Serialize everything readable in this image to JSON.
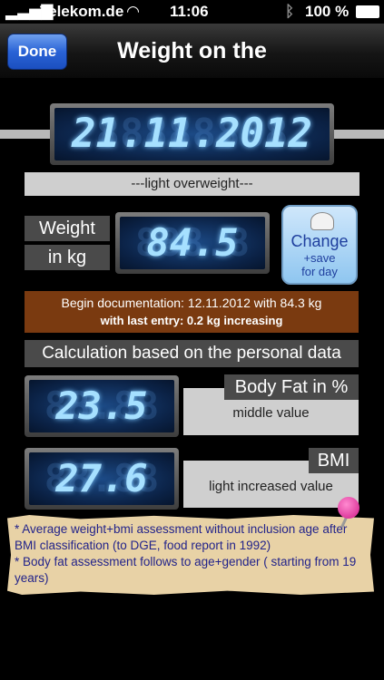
{
  "status": {
    "carrier": "Telekom.de",
    "time": "11:06",
    "battery": "100 %"
  },
  "nav": {
    "done_label": "Done",
    "title": "Weight on the"
  },
  "date_display": "21.11.2012",
  "classification": "---light overweight---",
  "weight": {
    "label_line1": "Weight",
    "label_line2": "in kg",
    "value": "84.5"
  },
  "change_button": {
    "line1": "Change",
    "line2": "+save",
    "line3": "for day"
  },
  "documentation": {
    "line1": "Begin documentation: 12.11.2012 with 84.3 kg",
    "line2": "with last entry: 0.2 kg increasing"
  },
  "calc_header": "Calculation based on the personal data",
  "body_fat": {
    "value": "23.5",
    "title": "Body Fat in %",
    "assessment": "middle value"
  },
  "bmi": {
    "value": "27.6",
    "title": "BMI",
    "assessment": "light increased value"
  },
  "notes": [
    "* Average weight+bmi assessment without inclusion age after BMI classification (to DGE, food report in 1992)",
    "* Body fat assessment follows to age+gender ( starting from 19 years)"
  ]
}
